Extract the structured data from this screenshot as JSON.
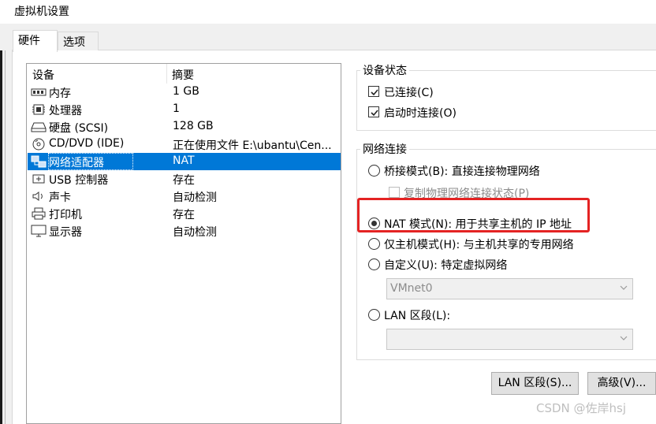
{
  "window": {
    "title": "虚拟机设置"
  },
  "tabs": [
    {
      "label": "硬件",
      "active": true
    },
    {
      "label": "选项",
      "active": false
    }
  ],
  "device_list": {
    "columns": [
      "设备",
      "摘要"
    ],
    "rows": [
      {
        "icon": "memory-icon",
        "name": "内存",
        "summary": "1 GB"
      },
      {
        "icon": "processor-icon",
        "name": "处理器",
        "summary": "1"
      },
      {
        "icon": "hard-disk-icon",
        "name": "硬盘 (SCSI)",
        "summary": "128 GB"
      },
      {
        "icon": "cd-dvd-icon",
        "name": "CD/DVD (IDE)",
        "summary": "正在使用文件 E:\\ubantu\\Cen..."
      },
      {
        "icon": "network-adapter-icon",
        "name": "网络适配器",
        "summary": "NAT",
        "selected": true
      },
      {
        "icon": "usb-icon",
        "name": "USB 控制器",
        "summary": "存在"
      },
      {
        "icon": "sound-card-icon",
        "name": "声卡",
        "summary": "自动检测"
      },
      {
        "icon": "printer-icon",
        "name": "打印机",
        "summary": "存在"
      },
      {
        "icon": "display-icon",
        "name": "显示器",
        "summary": "自动检测"
      }
    ]
  },
  "device_status": {
    "title": "设备状态",
    "connected": {
      "label": "已连接(C)",
      "checked": true
    },
    "connect_at_power_on": {
      "label": "启动时连接(O)",
      "checked": true
    }
  },
  "network_connection": {
    "title": "网络连接",
    "bridged": {
      "label": "桥接模式(B): 直接连接物理网络",
      "selected": false
    },
    "replicate": {
      "label": "复制物理网络连接状态(P)",
      "checked": false,
      "disabled": true
    },
    "nat": {
      "label": "NAT 模式(N): 用于共享主机的 IP 地址",
      "selected": true
    },
    "host_only": {
      "label": "仅主机模式(H): 与主机共享的专用网络",
      "selected": false
    },
    "custom": {
      "label": "自定义(U): 特定虚拟网络",
      "selected": false
    },
    "custom_select": {
      "value": "VMnet0"
    },
    "lan_segment": {
      "label": "LAN 区段(L):",
      "selected": false
    },
    "lan_select": {
      "value": ""
    }
  },
  "buttons": {
    "lan_segments": "LAN 区段(S)...",
    "advanced": "高级(V)..."
  },
  "watermark": "CSDN @佐岸hsj",
  "colors": {
    "selection": "#0078d7",
    "highlight_box": "#e42323",
    "panel_bg": "#f0f0f0"
  }
}
